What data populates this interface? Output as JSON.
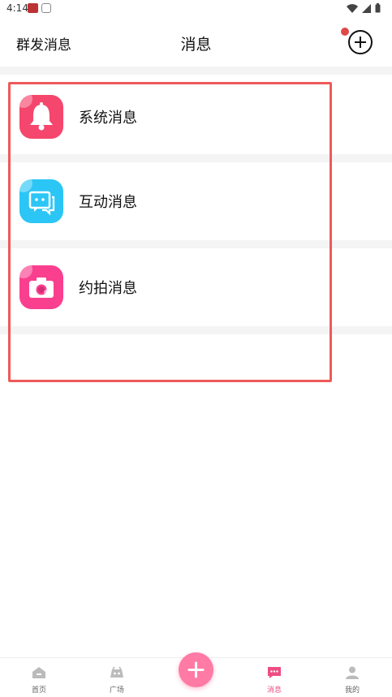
{
  "status_bar": {
    "time": "4:14"
  },
  "header": {
    "left_label": "群发消息",
    "title": "消息"
  },
  "messages": [
    {
      "label": "系统消息",
      "icon": "bell-icon",
      "color": "#f5466d"
    },
    {
      "label": "互动消息",
      "icon": "chat-bubble-icon",
      "color": "#2bc6f5"
    },
    {
      "label": "约拍消息",
      "icon": "camera-icon",
      "color": "#fa3f8f"
    }
  ],
  "tabbar": {
    "items": [
      {
        "label": "首页",
        "icon": "home-icon"
      },
      {
        "label": "广场",
        "icon": "square-icon"
      },
      {
        "label": "消息",
        "icon": "message-icon",
        "active": true
      },
      {
        "label": "我的",
        "icon": "profile-icon"
      }
    ]
  },
  "colors": {
    "accent": "#ee4d82",
    "highlight_border": "#ee5a5a",
    "badge": "#e04848"
  }
}
